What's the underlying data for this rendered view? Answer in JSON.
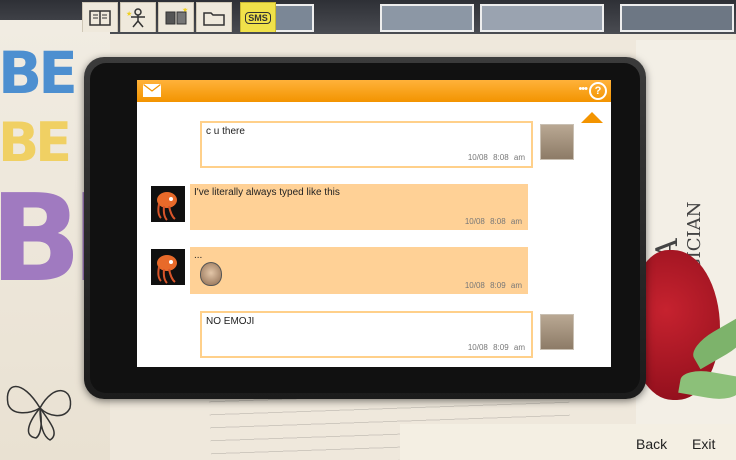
{
  "toolbar": {
    "tabs": [
      {
        "id": "journal",
        "icon": "journal-icon"
      },
      {
        "id": "character",
        "icon": "character-icon"
      },
      {
        "id": "photos",
        "icon": "photos-icon"
      },
      {
        "id": "folder",
        "icon": "folder-icon"
      },
      {
        "id": "sms",
        "icon": "sms-icon",
        "label": "SMS"
      }
    ]
  },
  "phone": {
    "help_label": "?",
    "messages": [
      {
        "direction": "out",
        "text": "c u there",
        "date": "10/08",
        "time": "8:08 am"
      },
      {
        "direction": "in",
        "text": "I've literally always typed like this",
        "date": "10/08",
        "time": "8:08 am"
      },
      {
        "direction": "in",
        "text": "...",
        "date": "10/08",
        "time": "8:09 am",
        "attachment": "face-icon"
      },
      {
        "direction": "out",
        "text": "NO EMOJI",
        "date": "10/08",
        "time": "8:09 am"
      }
    ]
  },
  "nav": {
    "back_label": "Back",
    "exit_label": "Exit"
  },
  "colors": {
    "header": "#f39400",
    "incoming_bubble": "#ffd196",
    "outgoing_border": "#ffd08a"
  }
}
